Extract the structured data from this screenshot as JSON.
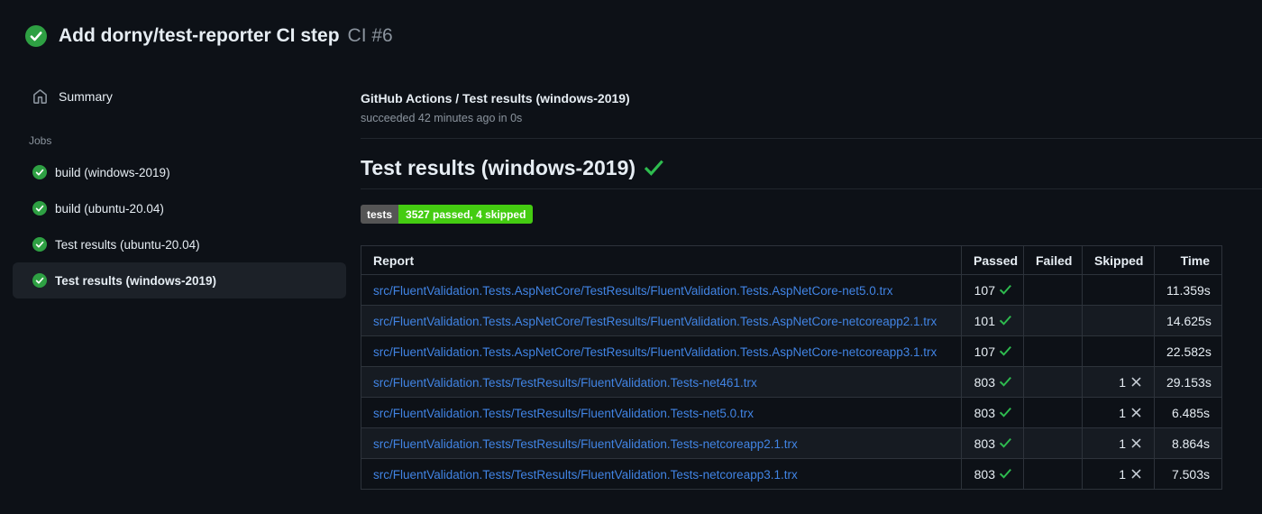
{
  "colors": {
    "bg": "#0d1117",
    "accent_link": "#4184e4",
    "success_green": "#2ea043",
    "badge_label_bg": "#555555",
    "badge_value_bg": "#44cc11"
  },
  "header": {
    "status_icon": "check-circle-icon",
    "title": "Add dorny/test-reporter CI step",
    "run_ref": "CI #6"
  },
  "sidebar": {
    "summary_label": "Summary",
    "jobs_heading": "Jobs",
    "jobs": [
      {
        "label": "build (windows-2019)",
        "status": "success",
        "selected": false
      },
      {
        "label": "build (ubuntu-20.04)",
        "status": "success",
        "selected": false
      },
      {
        "label": "Test results (ubuntu-20.04)",
        "status": "success",
        "selected": false
      },
      {
        "label": "Test results (windows-2019)",
        "status": "success",
        "selected": true
      }
    ]
  },
  "main": {
    "run_title": "GitHub Actions / Test results (windows-2019)",
    "run_status_line": "succeeded 42 minutes ago in 0s",
    "section_title": "Test results (windows-2019)",
    "section_status": "success",
    "badge": {
      "label": "tests",
      "value": "3527 passed, 4 skipped"
    },
    "table": {
      "headers": [
        "Report",
        "Passed",
        "Failed",
        "Skipped",
        "Time"
      ],
      "rows": [
        {
          "report": "src/FluentValidation.Tests.AspNetCore/TestResults/FluentValidation.Tests.AspNetCore-net5.0.trx",
          "passed": "107",
          "failed": "",
          "skipped": "",
          "time": "11.359s"
        },
        {
          "report": "src/FluentValidation.Tests.AspNetCore/TestResults/FluentValidation.Tests.AspNetCore-netcoreapp2.1.trx",
          "passed": "101",
          "failed": "",
          "skipped": "",
          "time": "14.625s"
        },
        {
          "report": "src/FluentValidation.Tests.AspNetCore/TestResults/FluentValidation.Tests.AspNetCore-netcoreapp3.1.trx",
          "passed": "107",
          "failed": "",
          "skipped": "",
          "time": "22.582s"
        },
        {
          "report": "src/FluentValidation.Tests/TestResults/FluentValidation.Tests-net461.trx",
          "passed": "803",
          "failed": "",
          "skipped": "1",
          "time": "29.153s"
        },
        {
          "report": "src/FluentValidation.Tests/TestResults/FluentValidation.Tests-net5.0.trx",
          "passed": "803",
          "failed": "",
          "skipped": "1",
          "time": "6.485s"
        },
        {
          "report": "src/FluentValidation.Tests/TestResults/FluentValidation.Tests-netcoreapp2.1.trx",
          "passed": "803",
          "failed": "",
          "skipped": "1",
          "time": "8.864s"
        },
        {
          "report": "src/FluentValidation.Tests/TestResults/FluentValidation.Tests-netcoreapp3.1.trx",
          "passed": "803",
          "failed": "",
          "skipped": "1",
          "time": "7.503s"
        }
      ]
    }
  }
}
